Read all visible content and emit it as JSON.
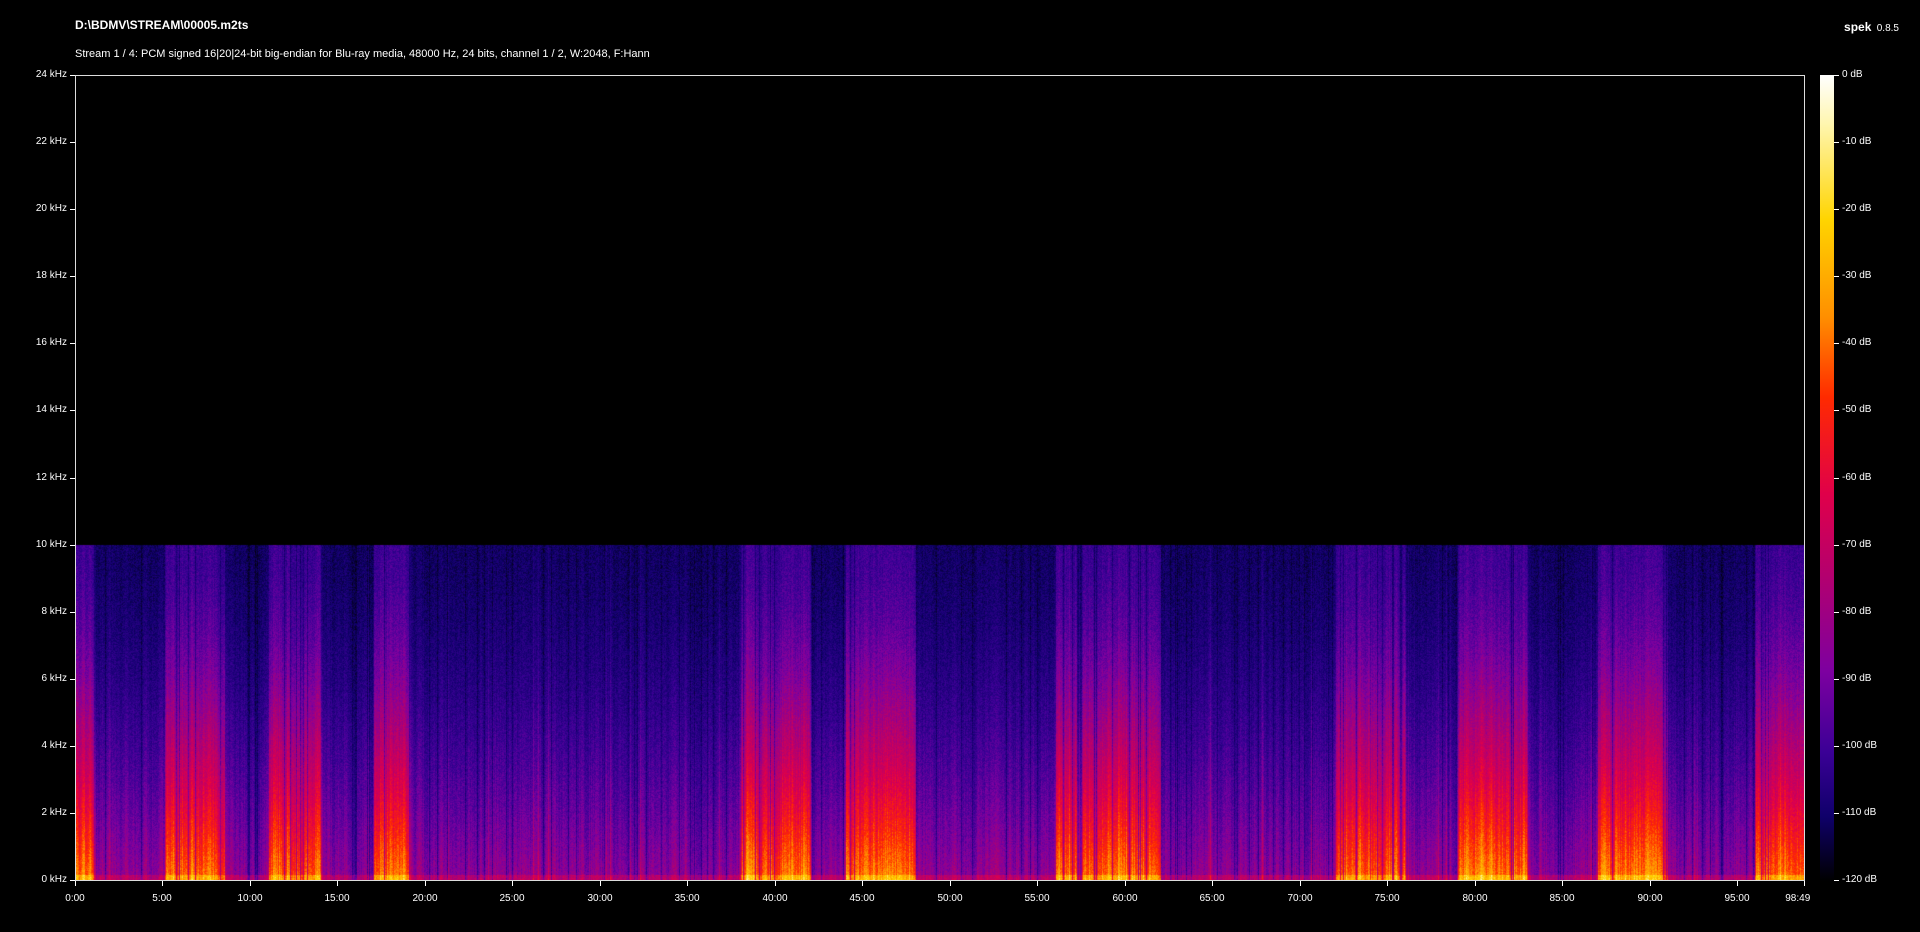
{
  "header": {
    "file_path": "D:\\BDMV\\STREAM\\00005.m2ts",
    "stream_info": "Stream 1 / 4: PCM signed 16|20|24-bit big-endian for Blu-ray media, 48000 Hz, 24 bits, channel 1 / 2, W:2048, F:Hann",
    "app_name": "spek",
    "app_version": "0.8.5"
  },
  "axes": {
    "frequency_labels": [
      "24 kHz",
      "22 kHz",
      "20 kHz",
      "18 kHz",
      "16 kHz",
      "14 kHz",
      "12 kHz",
      "10 kHz",
      "8 kHz",
      "6 kHz",
      "4 kHz",
      "2 kHz",
      "0 kHz"
    ],
    "time_labels": [
      "0:00",
      "5:00",
      "10:00",
      "15:00",
      "20:00",
      "25:00",
      "30:00",
      "35:00",
      "40:00",
      "45:00",
      "50:00",
      "55:00",
      "60:00",
      "65:00",
      "70:00",
      "75:00",
      "80:00",
      "85:00",
      "90:00",
      "95:00",
      "98:49"
    ],
    "time_values_seconds": [
      0,
      300,
      600,
      900,
      1200,
      1500,
      1800,
      2100,
      2400,
      2700,
      3000,
      3300,
      3600,
      3900,
      4200,
      4500,
      4800,
      5100,
      5400,
      5700,
      5929
    ],
    "duration_seconds": 5929,
    "frequency_max_khz": 24,
    "db_labels": [
      "0 dB",
      "-10 dB",
      "-20 dB",
      "-30 dB",
      "-40 dB",
      "-50 dB",
      "-60 dB",
      "-70 dB",
      "-80 dB",
      "-90 dB",
      "-100 dB",
      "-110 dB",
      "-120 dB"
    ]
  },
  "spectrogram": {
    "content_cutoff_khz": 10,
    "loud_sections_minutes": [
      [
        0,
        1
      ],
      [
        5,
        8.5
      ],
      [
        11,
        14
      ],
      [
        17,
        19
      ],
      [
        38,
        42
      ],
      [
        44,
        48
      ],
      [
        56,
        62
      ],
      [
        72,
        76
      ],
      [
        79,
        83
      ],
      [
        87,
        91
      ],
      [
        96,
        99
      ]
    ],
    "colormap": [
      "#000000",
      "#0f006a",
      "#3b0096",
      "#7d00a0",
      "#b4006e",
      "#e0004a",
      "#ff2a00",
      "#ff8f00",
      "#ffd400",
      "#fff6b0",
      "#ffffff"
    ]
  }
}
